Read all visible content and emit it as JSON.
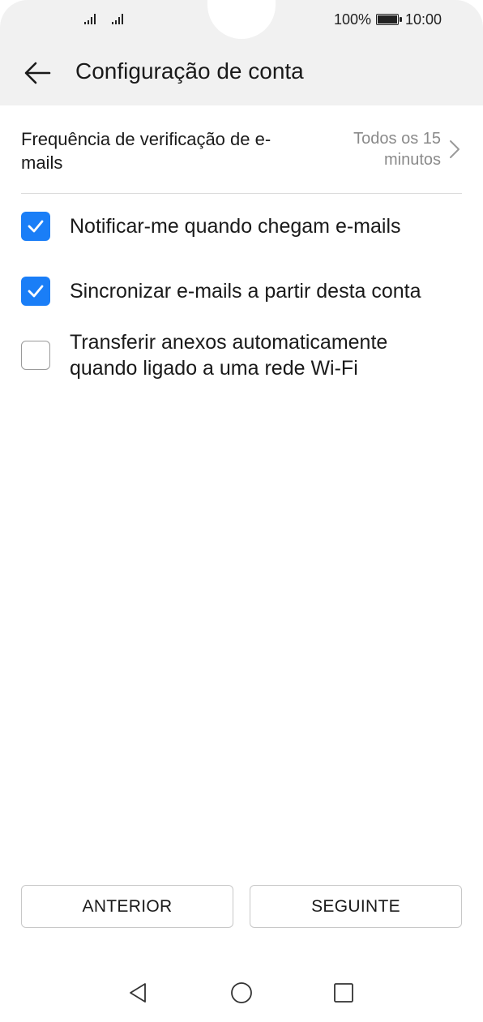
{
  "status_bar": {
    "battery_percent": "100%",
    "time": "10:00",
    "icons": [
      "signal-icon",
      "signal-icon",
      "battery-icon"
    ]
  },
  "header": {
    "back_icon": "arrow-left-icon",
    "title": "Configuração de conta"
  },
  "frequency": {
    "label": "Frequência de verificação de e-mails",
    "value": "Todos os 15 minutos",
    "icon": "chevron-right-icon"
  },
  "options": [
    {
      "label": "Notificar-me quando chegam e-mails",
      "checked": true
    },
    {
      "label": "Sincronizar e-mails a partir desta conta",
      "checked": true
    },
    {
      "label": "Transferir anexos automaticamente quando ligado a uma rede Wi-Fi",
      "checked": false
    }
  ],
  "buttons": {
    "previous": "ANTERIOR",
    "next": "SEGUINTE"
  },
  "nav_bar": {
    "icons": [
      "nav-back-icon",
      "nav-home-icon",
      "nav-recent-icon"
    ]
  },
  "colors": {
    "accent": "#1a7ef7",
    "header_bg": "#f1f1f1",
    "secondary_text": "#8a8a8a"
  }
}
